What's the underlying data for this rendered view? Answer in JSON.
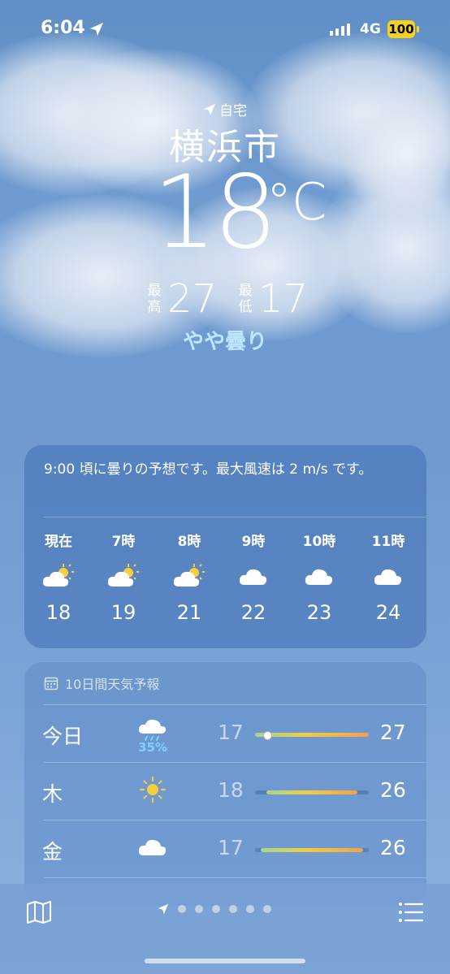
{
  "status_bar": {
    "time": "6:04",
    "network": "4G",
    "battery": "100"
  },
  "location": {
    "label": "自宅",
    "city": "横浜市"
  },
  "current": {
    "temperature": "18",
    "unit": "°C",
    "high_label": "最高",
    "high": "27",
    "low_label": "最低",
    "low": "17",
    "condition": "やや曇り"
  },
  "hourly": {
    "summary": "9:00 頃に曇りの予想です。最大風速は 2 m/s です。",
    "items": [
      {
        "label": "現在",
        "icon": "partly-cloudy-icon",
        "temp": "18"
      },
      {
        "label": "7時",
        "icon": "partly-cloudy-icon",
        "temp": "19"
      },
      {
        "label": "8時",
        "icon": "partly-cloudy-icon",
        "temp": "21"
      },
      {
        "label": "9時",
        "icon": "cloud-icon",
        "temp": "22"
      },
      {
        "label": "10時",
        "icon": "cloud-icon",
        "temp": "23"
      },
      {
        "label": "11時",
        "icon": "cloud-icon",
        "temp": "24"
      }
    ]
  },
  "daily": {
    "header": "10日間天気予報",
    "items": [
      {
        "day": "今日",
        "icon": "cloud-rain-icon",
        "precip": "35%",
        "low": "17",
        "high": "27",
        "range_start": 0.0,
        "range_end": 1.0,
        "current_marker": 0.1
      },
      {
        "day": "木",
        "icon": "sun-icon",
        "low": "18",
        "high": "26",
        "range_start": 0.1,
        "range_end": 0.9
      },
      {
        "day": "金",
        "icon": "cloud-icon",
        "low": "17",
        "high": "26",
        "range_start": 0.05,
        "range_end": 0.95
      }
    ]
  },
  "bottom_bar": {
    "pages": 6,
    "active_page": "location"
  }
}
